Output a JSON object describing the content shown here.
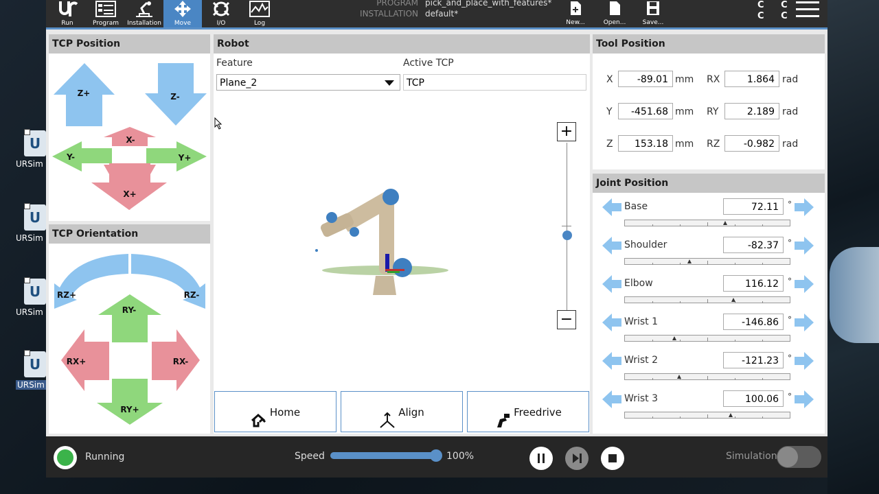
{
  "desktop": {
    "icons": [
      {
        "label": "URSim U",
        "selected": false
      },
      {
        "label": "URSim U",
        "selected": false
      },
      {
        "label": "URSim U",
        "selected": false
      },
      {
        "label": "URSim U",
        "selected": true
      }
    ]
  },
  "topbar": {
    "nav": [
      {
        "label": "Run",
        "icon": "ur-logo-icon"
      },
      {
        "label": "Program",
        "icon": "program-icon"
      },
      {
        "label": "Installation",
        "icon": "installation-icon"
      },
      {
        "label": "Move",
        "icon": "move-icon",
        "active": true
      },
      {
        "label": "I/O",
        "icon": "io-icon"
      },
      {
        "label": "Log",
        "icon": "log-icon"
      }
    ],
    "program_key": "PROGRAM",
    "program_value": "pick_and_place_with_features*",
    "installation_key": "INSTALLATION",
    "installation_value": "default*",
    "new_label": "New...",
    "open_label": "Open...",
    "save_label": "Save...",
    "cc_label": "C C"
  },
  "tcp_position": {
    "title": "TCP Position",
    "z_plus": "Z+",
    "z_minus": "Z-",
    "x_minus": "X-",
    "x_plus": "X+",
    "y_minus": "Y-",
    "y_plus": "Y+"
  },
  "tcp_orientation": {
    "title": "TCP Orientation",
    "rz_plus": "RZ+",
    "rz_minus": "RZ-",
    "ry_minus": "RY-",
    "ry_plus": "RY+",
    "rx_plus": "RX+",
    "rx_minus": "RX-"
  },
  "robot": {
    "title": "Robot",
    "feature_label": "Feature",
    "feature_value": "Plane_2",
    "active_tcp_label": "Active TCP",
    "active_tcp_value": "TCP",
    "zoom_in": "+",
    "zoom_out": "−",
    "home_label": "Home",
    "align_label": "Align",
    "freedrive_label": "Freedrive"
  },
  "tool_position": {
    "title": "Tool Position",
    "rows": [
      {
        "axis": "X",
        "value": "-89.01",
        "unit": "mm",
        "raxis": "RX",
        "rvalue": "1.864",
        "runit": "rad"
      },
      {
        "axis": "Y",
        "value": "-451.68",
        "unit": "mm",
        "raxis": "RY",
        "rvalue": "2.189",
        "runit": "rad"
      },
      {
        "axis": "Z",
        "value": "153.18",
        "unit": "mm",
        "raxis": "RZ",
        "rvalue": "-0.982",
        "runit": "rad"
      }
    ]
  },
  "joint_position": {
    "title": "Joint Position",
    "degree_symbol": "°",
    "joints": [
      {
        "name": "Base",
        "value": "72.11",
        "fraction": 0.61
      },
      {
        "name": "Shoulder",
        "value": "-82.37",
        "fraction": 0.39
      },
      {
        "name": "Elbow",
        "value": "116.12",
        "fraction": 0.66
      },
      {
        "name": "Wrist 1",
        "value": "-146.86",
        "fraction": 0.3
      },
      {
        "name": "Wrist 2",
        "value": "-121.23",
        "fraction": 0.33
      },
      {
        "name": "Wrist 3",
        "value": "100.06",
        "fraction": 0.64
      }
    ]
  },
  "status": {
    "state": "Running",
    "speed_label": "Speed",
    "speed_value": "100%",
    "speed_fraction": 1.0,
    "simulation_label": "Simulation",
    "colors": {
      "running": "#3bb34a",
      "accent": "#5a90c8"
    }
  }
}
